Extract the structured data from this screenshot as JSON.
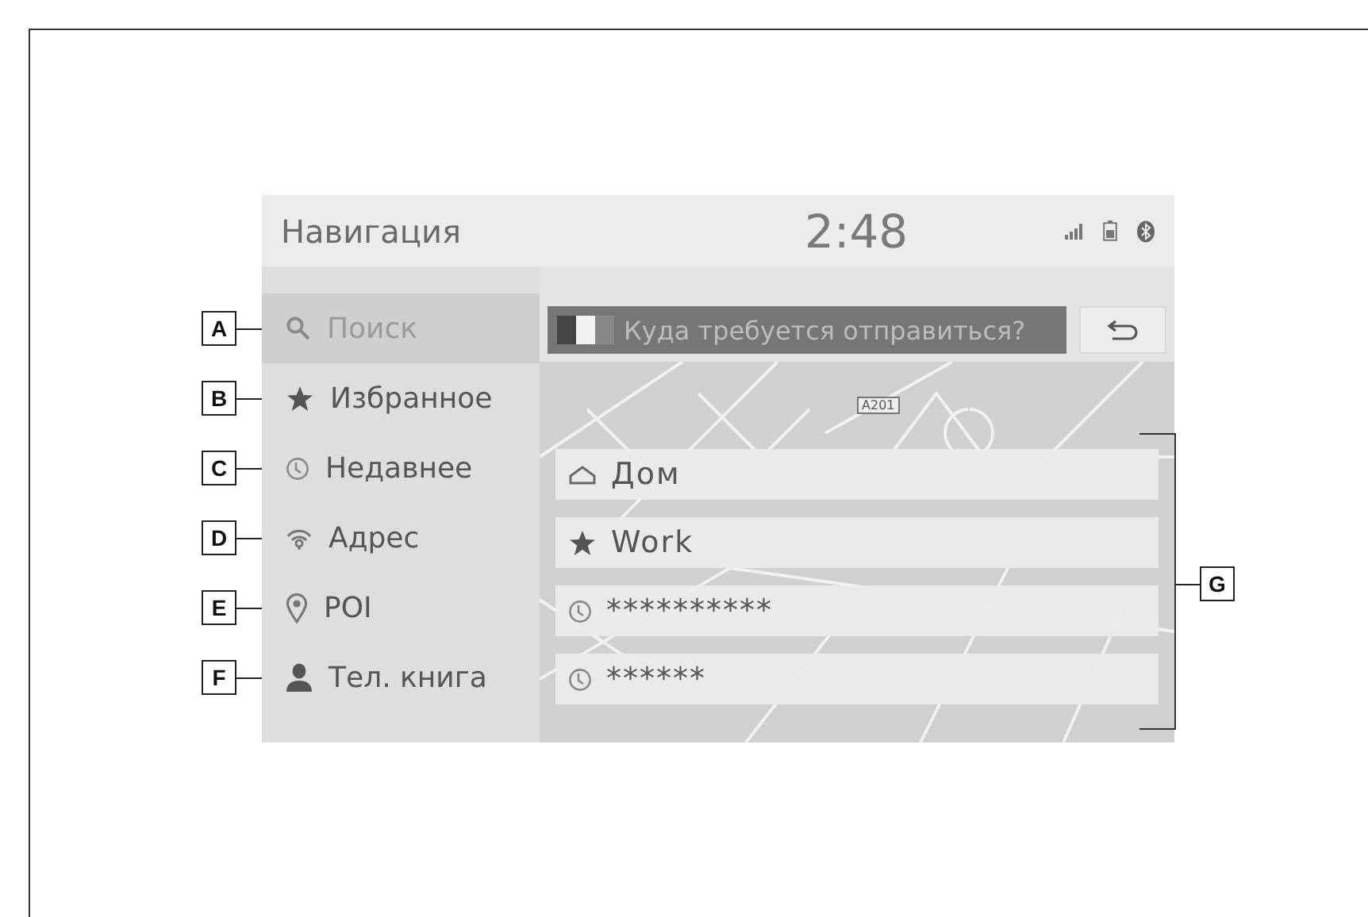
{
  "screen": {
    "title": "Навигация",
    "clock": "2:48"
  },
  "menu": [
    {
      "label": "Поиск",
      "selected": true
    },
    {
      "label": "Избранное",
      "selected": false
    },
    {
      "label": "Недавнее",
      "selected": false
    },
    {
      "label": "Адрес",
      "selected": false
    },
    {
      "label": "POI",
      "selected": false
    },
    {
      "label": "Тел. книга",
      "selected": false
    }
  ],
  "search": {
    "placeholder": "Куда требуется отправиться?"
  },
  "map": {
    "road_sign": "A201"
  },
  "destinations": [
    {
      "label": "Дом",
      "kind": "home"
    },
    {
      "label": "Work",
      "kind": "favorite"
    },
    {
      "label": "**********",
      "kind": "recent"
    },
    {
      "label": "******",
      "kind": "recent"
    }
  ],
  "callouts": [
    "A",
    "B",
    "C",
    "D",
    "E",
    "F"
  ],
  "list_callout": "G"
}
